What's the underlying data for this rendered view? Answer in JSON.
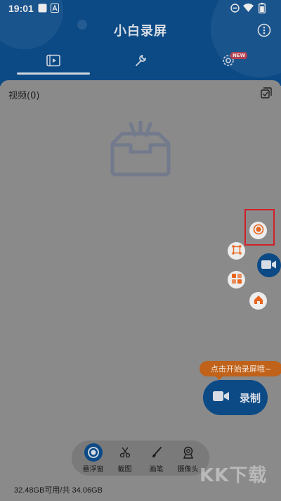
{
  "status_bar": {
    "time": "19:01"
  },
  "header": {
    "title": "小白录屏"
  },
  "tabs": [
    {
      "name": "videos",
      "icon": "video-file-icon"
    },
    {
      "name": "tools",
      "icon": "wrench-icon"
    },
    {
      "name": "settings",
      "icon": "gear-icon",
      "badge": "NEW"
    }
  ],
  "content": {
    "section_label": "视频(0)"
  },
  "floating_menu": [
    {
      "name": "record",
      "icon": "record-icon"
    },
    {
      "name": "crop",
      "icon": "crop-icon"
    },
    {
      "name": "apps",
      "icon": "apps-icon"
    },
    {
      "name": "home",
      "icon": "home-icon"
    }
  ],
  "tooltip": "点击开始录屏哦~",
  "record_button": {
    "label": "录制"
  },
  "toolbar": [
    {
      "label": "悬浮窗",
      "icon": "floating-window-icon",
      "active": true
    },
    {
      "label": "截图",
      "icon": "scissors-icon",
      "active": false
    },
    {
      "label": "画笔",
      "icon": "brush-icon",
      "active": false
    },
    {
      "label": "摄像头",
      "icon": "camera-icon",
      "active": false
    }
  ],
  "storage": "32.48GB可用/共 34.06GB",
  "watermark": "KK下载",
  "colors": {
    "primary": "#0c4a86",
    "accent": "#e8651d",
    "highlight": "#d0202a"
  }
}
